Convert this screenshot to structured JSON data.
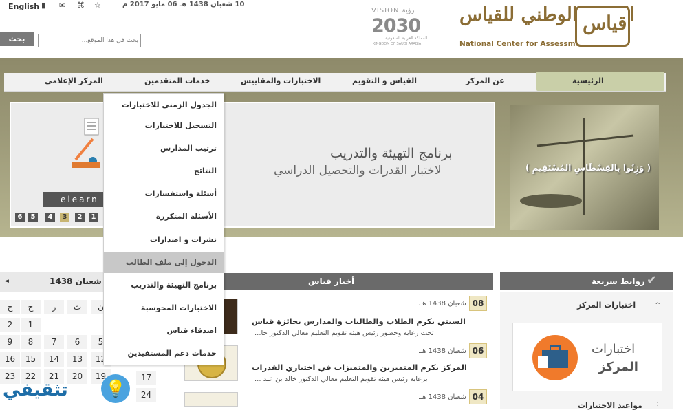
{
  "header": {
    "lang_link": "English",
    "date": "10 شعبان 1438 هـ 06 مايو 2017 م",
    "search_button": "بحث",
    "search_placeholder": "بحث في هذا الموقع...",
    "vision": {
      "top": "VISION رؤية",
      "number": "2030",
      "sub_ar": "المملكة العربية السعودية",
      "sub_en": "KINGDOM OF SAUDI ARABIA"
    },
    "logo_ar": "المركز الوطني للقياس",
    "logo_en": "National Center for Assessment",
    "logo_mark": "قياس"
  },
  "nav": {
    "home": "الرئيسية",
    "about": "عن المركز",
    "measure": "القياس و التقويم",
    "tests": "الاختبارات والمقاييس",
    "applicants": "خدمات المتقدمين",
    "media": "المركز الإعلامي"
  },
  "dropdown": [
    "الجدول الزمني للاختبارات",
    "التسجيل للاختبارات",
    "ترتيب المدارس",
    "النتائج",
    "أسئلة واستفسارات",
    "الأسئلة المتكررة",
    "نشرات و اصدارات",
    "الدخول إلى ملف الطالب",
    "برنامج التهيئة والتدريب",
    "الاختبارات المحوسبة",
    "اصدقاء قياس",
    "خدمات دعم المستفيدين"
  ],
  "slider": {
    "line1": "برنامج التهيئة والتدريب",
    "line2": "لاختبار القدرات والتحصيل الدراسي",
    "elearn": "elearn",
    "pages": [
      "6",
      "5",
      "4",
      "3",
      "2",
      "1"
    ],
    "active_page": "3",
    "side_text": "( وَزِنُوا بِالقِسْطَاسِ المُسْتَقِيمِ )"
  },
  "calendar": {
    "title": "شعبان 1438",
    "prev": "◄",
    "weekdays": [
      "ح",
      "خ",
      "ر",
      "ث",
      "ن"
    ],
    "rows": [
      [
        "2",
        "1",
        "",
        "",
        ""
      ],
      [
        "9",
        "8",
        "7",
        "6",
        "5"
      ],
      [
        "16",
        "15",
        "14",
        "13",
        "12"
      ],
      [
        "23",
        "22",
        "21",
        "20",
        "19"
      ],
      [
        "",
        "",
        "",
        "",
        ""
      ]
    ],
    "extra": [
      "17",
      "24"
    ]
  },
  "news": {
    "title": "أخبار قياس",
    "items": [
      {
        "day": "08",
        "when": "شعبان 1438 هـ.",
        "title": "السبتي يكرم الطلاب والطالبات والمدارس بجائزة قياس",
        "excerpt": "تحت رعاية وحضور رئيس هيئة تقويم التعليم معالي الدكتور خا..."
      },
      {
        "day": "06",
        "when": "شعبان 1438 هـ.",
        "title": "المركز يكرم المتميزين والمتميزات في اختباري القدرات",
        "excerpt": "برعاية رئيس هيئة تقويم التعليم معالي الدكتور خالد بن عبد ..."
      },
      {
        "day": "04",
        "when": "شعبان 1438 هـ.",
        "title": "",
        "excerpt": ""
      }
    ]
  },
  "quick_links": {
    "title": "روابط سريعة",
    "item1": "اختبارات المركز",
    "card_line1": "اختبارات",
    "card_line2": "المركز",
    "item2": "مواعيد الاختبارات"
  },
  "watermark": "تثقيفي",
  "colors": {
    "brand": "#8b6d35",
    "nav_active": "#c9cfa8",
    "panel_dark": "#6a6a6a"
  }
}
